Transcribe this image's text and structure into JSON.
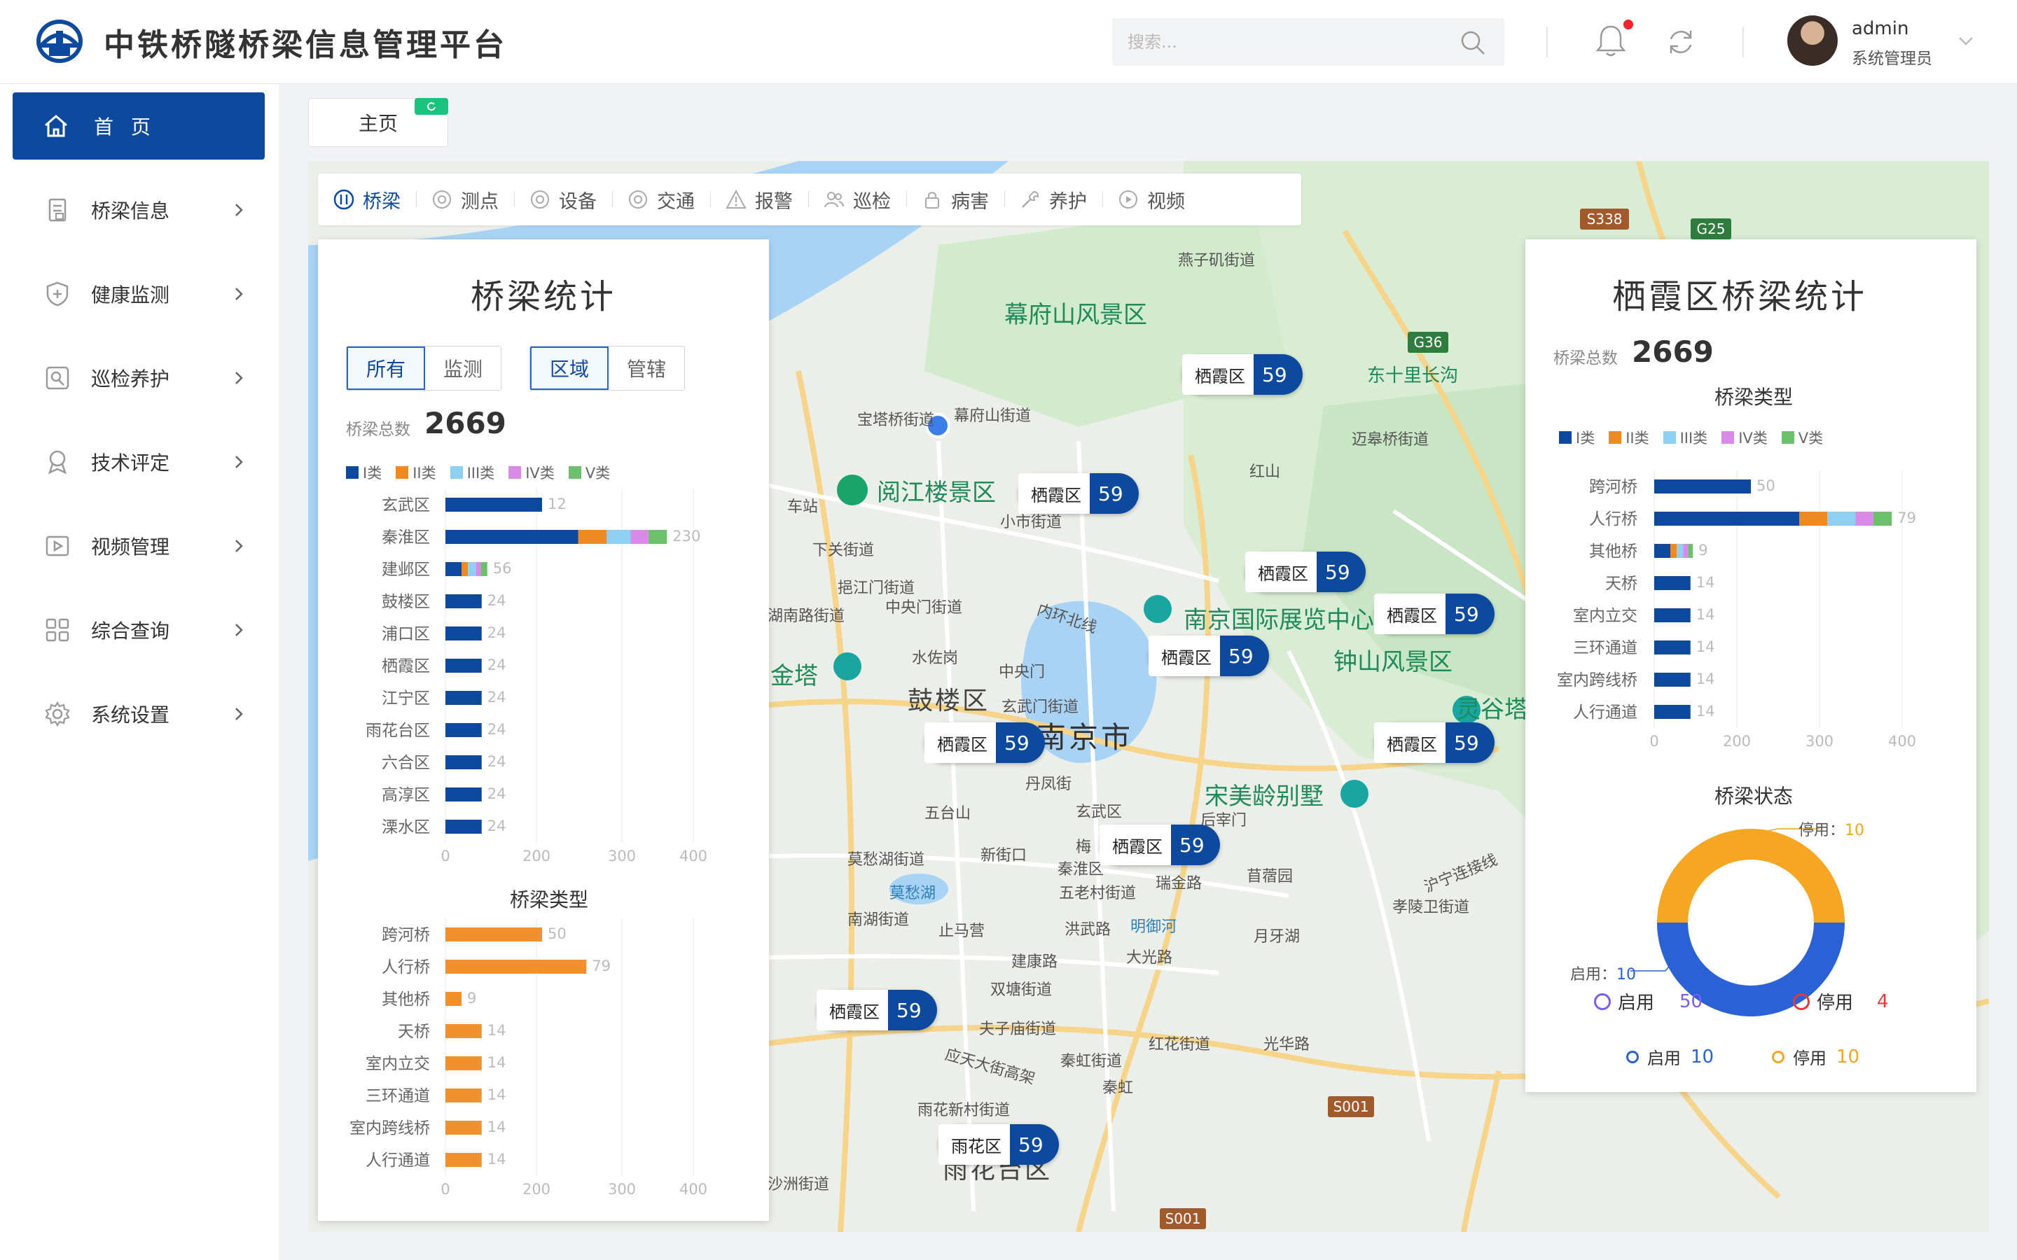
{
  "app": {
    "title": "中铁桥隧桥梁信息管理平台"
  },
  "header": {
    "search_placeholder": "搜索...",
    "user_name": "admin",
    "user_role": "系统管理员"
  },
  "sidebar": {
    "items": [
      {
        "label": "首 页",
        "icon": "home-icon"
      },
      {
        "label": "桥梁信息",
        "icon": "document-icon"
      },
      {
        "label": "健康监测",
        "icon": "shield-icon"
      },
      {
        "label": "巡检养护",
        "icon": "inspection-icon"
      },
      {
        "label": "技术评定",
        "icon": "award-icon"
      },
      {
        "label": "视频管理",
        "icon": "video-icon"
      },
      {
        "label": "综合查询",
        "icon": "grid-icon"
      },
      {
        "label": "系统设置",
        "icon": "gear-icon"
      }
    ]
  },
  "tabs": {
    "home": "主页"
  },
  "map_toolbar": {
    "items": [
      {
        "label": "桥梁",
        "icon": "bridge-icon"
      },
      {
        "label": "测点",
        "icon": "target-icon"
      },
      {
        "label": "设备",
        "icon": "device-icon"
      },
      {
        "label": "交通",
        "icon": "traffic-icon"
      },
      {
        "label": "报警",
        "icon": "warning-icon"
      },
      {
        "label": "巡检",
        "icon": "people-icon"
      },
      {
        "label": "病害",
        "icon": "lock-icon"
      },
      {
        "label": "养护",
        "icon": "wrench-icon"
      },
      {
        "label": "视频",
        "icon": "play-icon"
      }
    ]
  },
  "map": {
    "markers": [
      {
        "name": "栖霞区",
        "count": "59"
      },
      {
        "name": "栖霞区",
        "count": "59"
      },
      {
        "name": "栖霞区",
        "count": "59"
      },
      {
        "name": "栖霞区",
        "count": "59"
      },
      {
        "name": "栖霞区",
        "count": "59"
      },
      {
        "name": "栖霞区",
        "count": "59"
      },
      {
        "name": "栖霞区",
        "count": "59"
      },
      {
        "name": "栖霞区",
        "count": "59"
      },
      {
        "name": "栖霞区",
        "count": "59"
      },
      {
        "name": "雨花区",
        "count": "59"
      }
    ],
    "labels": [
      "燕子矶街道",
      "幕府山风景区",
      "东十里长沟",
      "迈皋桥街道",
      "宝塔桥街道",
      "幕府山街道",
      "阅江楼景区",
      "小市街道",
      "红山",
      "车站",
      "下关街道",
      "挹江门街道",
      "中央门街道",
      "内环北线",
      "南京国际展览中心",
      "钟山风景区",
      "水佐岗",
      "中央门",
      "湖南路街道",
      "金塔",
      "鼓楼区",
      "玄武门街道",
      "南京市",
      "灵谷塔",
      "丹凤街",
      "宋美龄别墅",
      "五台山",
      "玄武区",
      "后宰门",
      "新街口",
      "秦淮区",
      "梅",
      "莫愁湖街道",
      "瑞金路",
      "苜蓿园",
      "莫愁湖",
      "五老村街道",
      "南湖街道",
      "止马营",
      "洪武路",
      "明御河",
      "月牙湖",
      "孝陵卫街道",
      "建康路",
      "大光路",
      "双塘街道",
      "夫子庙街道",
      "红花街道",
      "光华路",
      "应天大街高架",
      "秦虹街道",
      "秦虹",
      "雨花新村街道",
      "雨花台区",
      "沙洲街道",
      "沪宁连接线",
      "S338",
      "G25",
      "G36",
      "S001",
      "S001"
    ]
  },
  "left_panel": {
    "title": "桥梁统计",
    "filter_a": [
      "所有",
      "监测"
    ],
    "filter_b": [
      "区域",
      "管辖"
    ],
    "total_label": "桥梁总数",
    "total_value": "2669",
    "legend": [
      "I类",
      "II类",
      "III类",
      "IV类",
      "V类"
    ],
    "type_chart_title": "桥梁类型"
  },
  "right_panel": {
    "title": "栖霞区桥梁统计",
    "total_label": "桥梁总数",
    "total_value": "2669",
    "type_title": "桥梁类型",
    "legend": [
      "I类",
      "II类",
      "III类",
      "IV类",
      "V类"
    ],
    "status_title": "桥梁状态",
    "status_callout_top": {
      "label": "停用：",
      "value": "10"
    },
    "status_callout_left": {
      "label": "启用：",
      "value": "10"
    },
    "status_mid_enabled": {
      "label": "启用",
      "value": "50"
    },
    "status_mid_disabled": {
      "label": "停用",
      "value": "4"
    },
    "status_legend": [
      {
        "label": "启用",
        "value": "10"
      },
      {
        "label": "停用",
        "value": "10"
      }
    ]
  },
  "colors": {
    "brand": "#0d4a9e",
    "class_I": "#0d4a9e",
    "class_II": "#ef8a22",
    "class_III": "#8fd0f2",
    "class_IV": "#d98ae8",
    "class_V": "#6cc06c",
    "orange": "#f0912e",
    "status_enabled": "#2a62d6",
    "status_disabled": "#f5a623"
  },
  "chart_data": [
    {
      "type": "bar",
      "orientation": "horizontal",
      "stacked": true,
      "categories": [
        "玄武区",
        "秦淮区",
        "建邺区",
        "鼓楼区",
        "浦口区",
        "栖霞区",
        "江宁区",
        "雨花台区",
        "六合区",
        "高淳区",
        "溧水区"
      ],
      "series": [
        {
          "name": "I类",
          "values": [
            120,
            165,
            20,
            45,
            45,
            45,
            45,
            45,
            45,
            45,
            45
          ]
        },
        {
          "name": "II类",
          "values": [
            0,
            35,
            8,
            0,
            0,
            0,
            0,
            0,
            0,
            0,
            0
          ]
        },
        {
          "name": "III类",
          "values": [
            0,
            30,
            10,
            0,
            0,
            0,
            0,
            0,
            0,
            0,
            0
          ]
        },
        {
          "name": "IV类",
          "values": [
            0,
            22,
            6,
            0,
            0,
            0,
            0,
            0,
            0,
            0,
            0
          ]
        },
        {
          "name": "V类",
          "values": [
            0,
            23,
            8,
            0,
            0,
            0,
            0,
            0,
            0,
            0,
            0
          ]
        }
      ],
      "data_labels": [
        "12",
        "230",
        "56",
        "24",
        "24",
        "24",
        "24",
        "24",
        "24",
        "24",
        "24"
      ],
      "xticks": [
        "0",
        "200",
        "300",
        "400"
      ],
      "xlim": [
        0,
        400
      ],
      "legend": [
        "I类",
        "II类",
        "III类",
        "IV类",
        "V类"
      ]
    },
    {
      "type": "bar",
      "orientation": "horizontal",
      "title": "桥梁类型",
      "categories": [
        "跨河桥",
        "人行桥",
        "其他桥",
        "天桥",
        "室内立交",
        "三环通道",
        "室内跨线桥",
        "人行通道"
      ],
      "values": [
        120,
        175,
        20,
        45,
        45,
        45,
        45,
        45
      ],
      "data_labels": [
        "50",
        "79",
        "9",
        "14",
        "14",
        "14",
        "14",
        "14"
      ],
      "xticks": [
        "0",
        "200",
        "300",
        "400"
      ],
      "xlim": [
        0,
        400
      ]
    },
    {
      "type": "bar",
      "orientation": "horizontal",
      "stacked": true,
      "title": "桥梁类型",
      "categories": [
        "跨河桥",
        "人行桥",
        "其他桥",
        "天桥",
        "室内立交",
        "三环通道",
        "室内跨线桥",
        "人行通道"
      ],
      "series": [
        {
          "name": "I类",
          "values": [
            120,
            180,
            20,
            45,
            45,
            45,
            45,
            45
          ]
        },
        {
          "name": "II类",
          "values": [
            0,
            35,
            8,
            0,
            0,
            0,
            0,
            0
          ]
        },
        {
          "name": "III类",
          "values": [
            0,
            35,
            8,
            0,
            0,
            0,
            0,
            0
          ]
        },
        {
          "name": "IV类",
          "values": [
            0,
            22,
            6,
            0,
            0,
            0,
            0,
            0
          ]
        },
        {
          "name": "V类",
          "values": [
            0,
            23,
            6,
            0,
            0,
            0,
            0,
            0
          ]
        }
      ],
      "data_labels": [
        "50",
        "79",
        "9",
        "14",
        "14",
        "14",
        "14",
        "14"
      ],
      "xticks": [
        "0",
        "200",
        "300",
        "400"
      ],
      "xlim": [
        0,
        400
      ],
      "legend": [
        "I类",
        "II类",
        "III类",
        "IV类",
        "V类"
      ]
    },
    {
      "type": "pie",
      "donut": true,
      "title": "桥梁状态",
      "slices": [
        {
          "name": "停用",
          "value": 10
        },
        {
          "name": "启用",
          "value": 10
        }
      ]
    }
  ]
}
